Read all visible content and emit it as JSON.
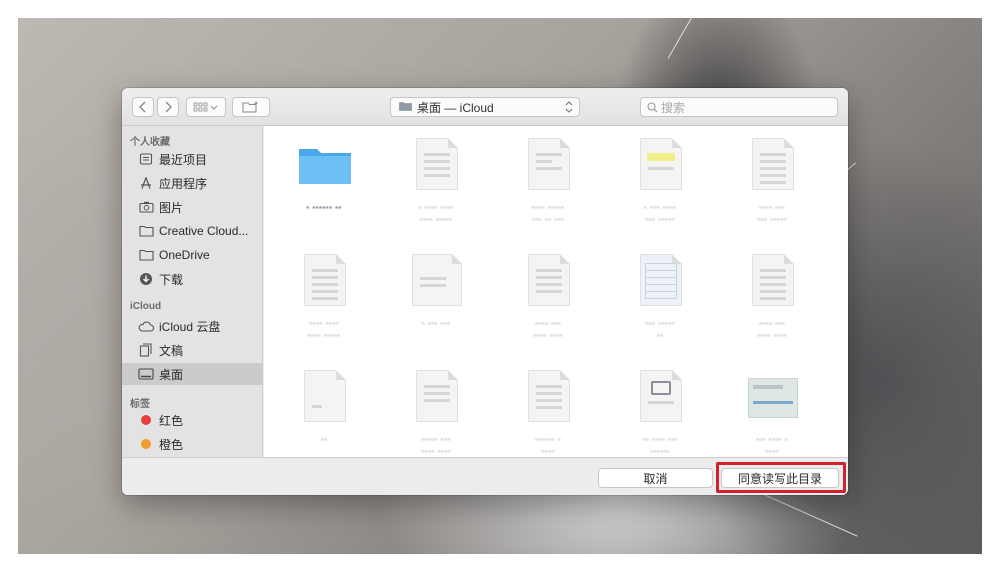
{
  "toolbar": {
    "path_label": "桌面 — iCloud",
    "search_placeholder": "搜索"
  },
  "sidebar": {
    "favorites_title": "个人收藏",
    "favorites": [
      {
        "label": "最近项目",
        "icon": "clock-icon"
      },
      {
        "label": "应用程序",
        "icon": "applications-icon"
      },
      {
        "label": "图片",
        "icon": "camera-icon"
      },
      {
        "label": "Creative Cloud...",
        "icon": "folder-icon"
      },
      {
        "label": "OneDrive",
        "icon": "folder-icon"
      },
      {
        "label": "下载",
        "icon": "download-icon"
      }
    ],
    "icloud_title": "iCloud",
    "icloud": [
      {
        "label": "iCloud 云盘",
        "icon": "cloud-icon"
      },
      {
        "label": "文稿",
        "icon": "documents-icon"
      },
      {
        "label": "桌面",
        "icon": "desktop-icon",
        "selected": true
      }
    ],
    "tags_title": "标签",
    "tags": [
      {
        "label": "红色",
        "color": "#e5403a"
      },
      {
        "label": "橙色",
        "color": "#f39a2c"
      }
    ]
  },
  "footer": {
    "cancel_label": "取消",
    "confirm_label": "同意读写此目录"
  },
  "colors": {
    "highlight": "#d4202a",
    "folder": "#5ab4ee"
  }
}
